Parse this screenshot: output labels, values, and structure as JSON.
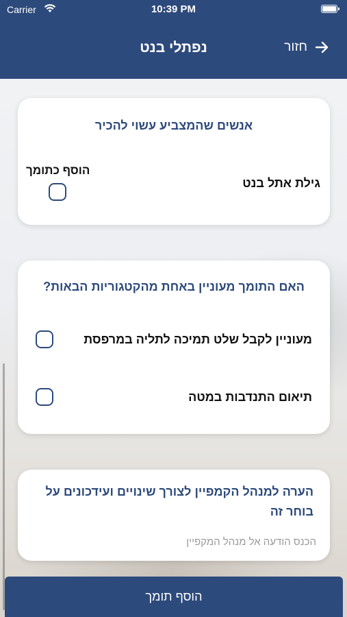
{
  "status_bar": {
    "carrier": "Carrier",
    "time": "10:39 PM",
    "icons": [
      "wifi-icon",
      "battery-icon"
    ]
  },
  "header": {
    "title": "נפתלי בנט",
    "back_label": "חזור",
    "back_icon": "arrow-right-icon",
    "color": "#2d4a7c"
  },
  "acquaintances_card": {
    "title": "אנשים שהמצביע עשוי להכיר",
    "person_name": "גילת אתל בנט",
    "add_supporter_label": "הוסף כתומך",
    "checked": false
  },
  "categories_card": {
    "title": "האם התומך מעוניין באחת מהקטגוריות הבאות?",
    "options": [
      {
        "label": "מעוניין לקבל שלט תמיכה לתליה במרפסת",
        "checked": false
      },
      {
        "label": "תיאום התנדבות במטה",
        "checked": false
      }
    ]
  },
  "note_card": {
    "title": "הערה למנהל הקמפיין לצורך שינויים ועידכונים על בוחר זה",
    "placeholder": "הכנס הודעה אל מנהל המקפיין",
    "value": ""
  },
  "footer": {
    "add_button_label": "הוסף תומך"
  }
}
